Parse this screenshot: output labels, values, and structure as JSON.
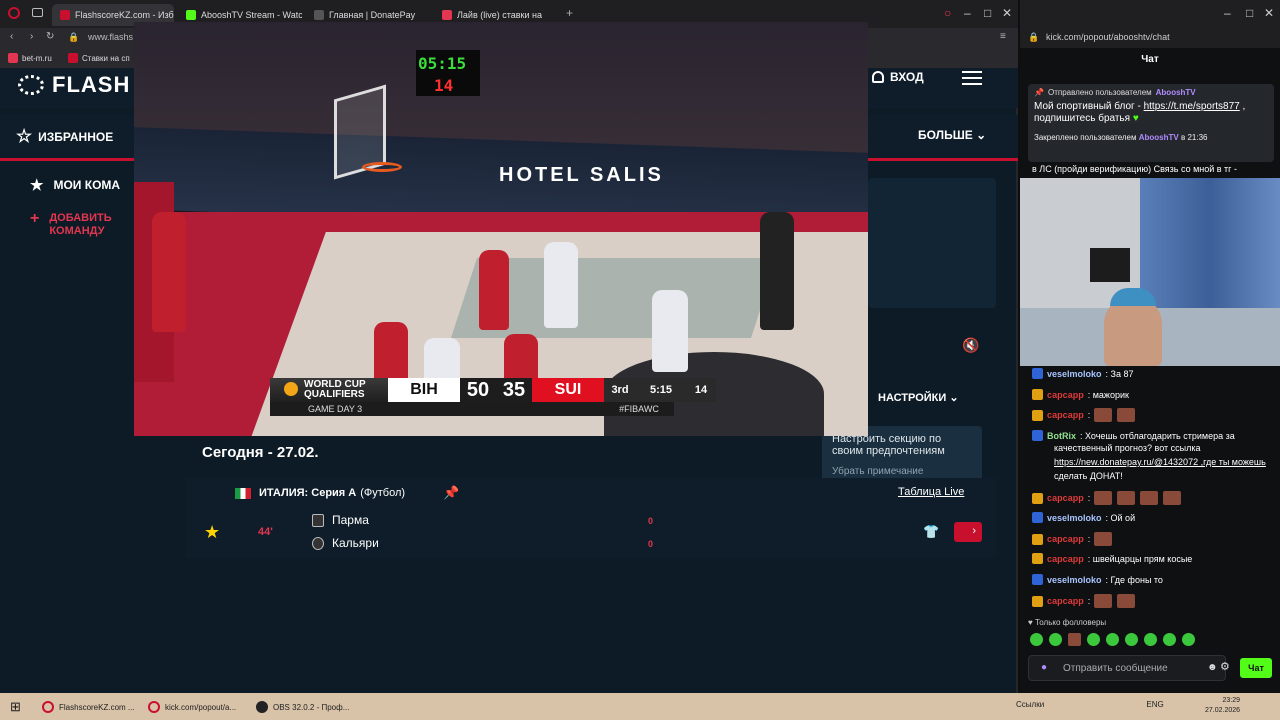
{
  "left_browser": {
    "tabs": [
      {
        "label": "FlashscoreKZ.com - Избр",
        "color": "#c8102e"
      },
      {
        "label": "AbooshTV Stream - Watc",
        "color": "#53fc18"
      },
      {
        "label": "Главная | DonatePay",
        "color": "#555555"
      },
      {
        "label": "Лайв (live) ставки на",
        "color": "#e33650"
      }
    ],
    "address": "www.flashs",
    "bookmarks": [
      "bet-m.ru",
      "Ставки на сп"
    ]
  },
  "flashscore": {
    "logo": "FLASH",
    "login": "ВХОД",
    "favorites": "ИЗБРАННОЕ",
    "more": "БОЛЬШЕ",
    "my_teams": "МОИ КОМА",
    "add_team": "ДОБАВИТЬ КОМАНДУ",
    "settings": "НАСТРОЙКИ",
    "tip_text": "Настроить секцию по своим предпочтениям",
    "tip_dismiss": "Убрать примечание",
    "date_heading": "Сегодня - 27.02.",
    "league": {
      "country": "ИТАЛИЯ: Серия А",
      "sport": "(Футбол)"
    },
    "table_live": "Таблица Live",
    "match": {
      "minute": "44'",
      "home": {
        "name": "Парма",
        "score": "0"
      },
      "away": {
        "name": "Кальяри",
        "score": "0"
      }
    }
  },
  "video": {
    "clock_game": "05:15",
    "clock_shot": "14",
    "ad_text": "HOTEL SALIS",
    "scorebug": {
      "competition": "WORLD CUP QUALIFIERS",
      "game_day": "GAME DAY 3",
      "home": "BIH",
      "home_score": "50",
      "away_score": "35",
      "away": "SUI",
      "period": "3rd",
      "time": "5:15",
      "shot_clock": "14",
      "hashtag": "#FIBAWC"
    }
  },
  "right_browser": {
    "address": "kick.com/popout/abooshtv/chat",
    "chat_title": "Чат",
    "pinned": {
      "sent_by_label": "Отправлено пользователем",
      "sent_by_user": "AbooshTV",
      "text": "Мой спортивный блог -",
      "link": "https://t.me/sports877",
      "text2": ", подпишитесь братья",
      "pinned_by_label": "Закреплено пользователем",
      "pinned_by_user": "AbooshTV",
      "pinned_time": "в 21:36"
    },
    "notice": "в ЛС (пройди верификацию) Связь со мной в тг -",
    "messages": [
      {
        "user": "veselmoloko",
        "text": ": За 87",
        "style": "blue"
      },
      {
        "user": "сарсарр",
        "text": ": мажорик",
        "style": "red"
      },
      {
        "user": "сарсарр",
        "text": ":",
        "style": "red",
        "emotes": 2
      },
      {
        "user": "BotRix",
        "text": ": Хочешь отблагодарить стримера за",
        "style": "green"
      },
      {
        "user": "",
        "text": "качественный прогноз? вот ссылка",
        "style": "plain"
      },
      {
        "user": "",
        "text": "https://new.donatepay.ru/@1432072 ,где ты можешь",
        "style": "plain"
      },
      {
        "user": "",
        "text": "сделать ДОНАТ!",
        "style": "plain"
      },
      {
        "user": "сарсарр",
        "text": ":",
        "style": "red",
        "emotes": 4
      },
      {
        "user": "veselmoloko",
        "text": ": Ой ой",
        "style": "blue"
      },
      {
        "user": "сарсарр",
        "text": ":",
        "style": "red",
        "emotes": 1
      },
      {
        "user": "сарсарр",
        "text": ": швейцарцы прям косые",
        "style": "red"
      },
      {
        "user": "veselmoloko",
        "text": ": Где фоны то",
        "style": "blue"
      },
      {
        "user": "сарсарр",
        "text": ":",
        "style": "red",
        "emotes": 2
      }
    ],
    "followers_only": "Только фолловеры",
    "input_placeholder": "Отправить сообщение",
    "send_label": "Чат"
  },
  "taskbar": {
    "items": [
      "FlashscoreKZ.com ...",
      "kick.com/popout/a...",
      "OBS 32.0.2 - Проф..."
    ],
    "tray_label": "Ссылки",
    "lang": "ENG",
    "time": "23:29",
    "date": "27.02.2026"
  }
}
